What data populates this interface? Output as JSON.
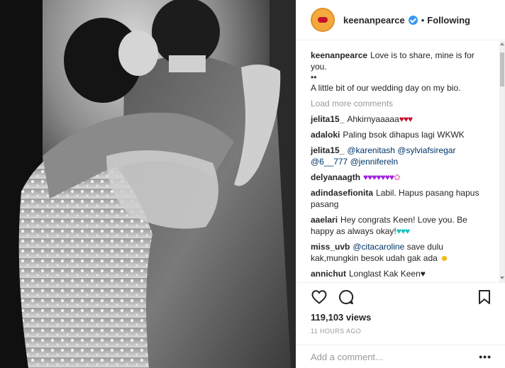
{
  "header": {
    "username": "keenanpearce",
    "separator": "•",
    "follow_label": "Following"
  },
  "caption": {
    "username": "keenanpearce",
    "line1": "Love is to share, mine is for you.",
    "line2": "••",
    "line3": "A little bit of our wedding day on my bio."
  },
  "load_more": "Load more comments",
  "comments": [
    {
      "user": "jelita15_",
      "text": "Ahkirnyaaaaa",
      "emoji": "♥♥♥"
    },
    {
      "user": "adaloki",
      "text": "Paling bsok dihapus lagi WKWK"
    },
    {
      "user": "jelita15_",
      "mentions": [
        "@karenitash",
        "@sylviafsiregar",
        "@6__777",
        "@jennifereln"
      ]
    },
    {
      "user": "delyanaagth",
      "emoji": "♥♥♥♥♥♥♥",
      "emoji2": "✿"
    },
    {
      "user": "adindasefionita",
      "text": "Labil. Hapus pasang hapus pasang"
    },
    {
      "user": "aaelari",
      "text": "Hey congrats Keen! Love you. Be happy as always okay!",
      "emoji": "♥♥♥"
    },
    {
      "user": "miss_uvb",
      "mention": "@citacaroline",
      "text": "save dulu kak,mungkin besok udah gak ada",
      "emoji": "☻"
    },
    {
      "user": "annichut",
      "text": "Longlast Kak Keen",
      "emoji": "♥"
    }
  ],
  "stats": {
    "views": "119,103 views",
    "time": "11 HOURS AGO"
  },
  "add_comment": {
    "placeholder": "Add a comment...",
    "more": "•••"
  },
  "icons": {
    "like": "heart-icon",
    "comment": "comment-icon",
    "save": "bookmark-icon",
    "verified": "verified-badge-icon"
  },
  "colors": {
    "verified": "#3897f0",
    "mention": "#003569",
    "muted": "#999999"
  }
}
